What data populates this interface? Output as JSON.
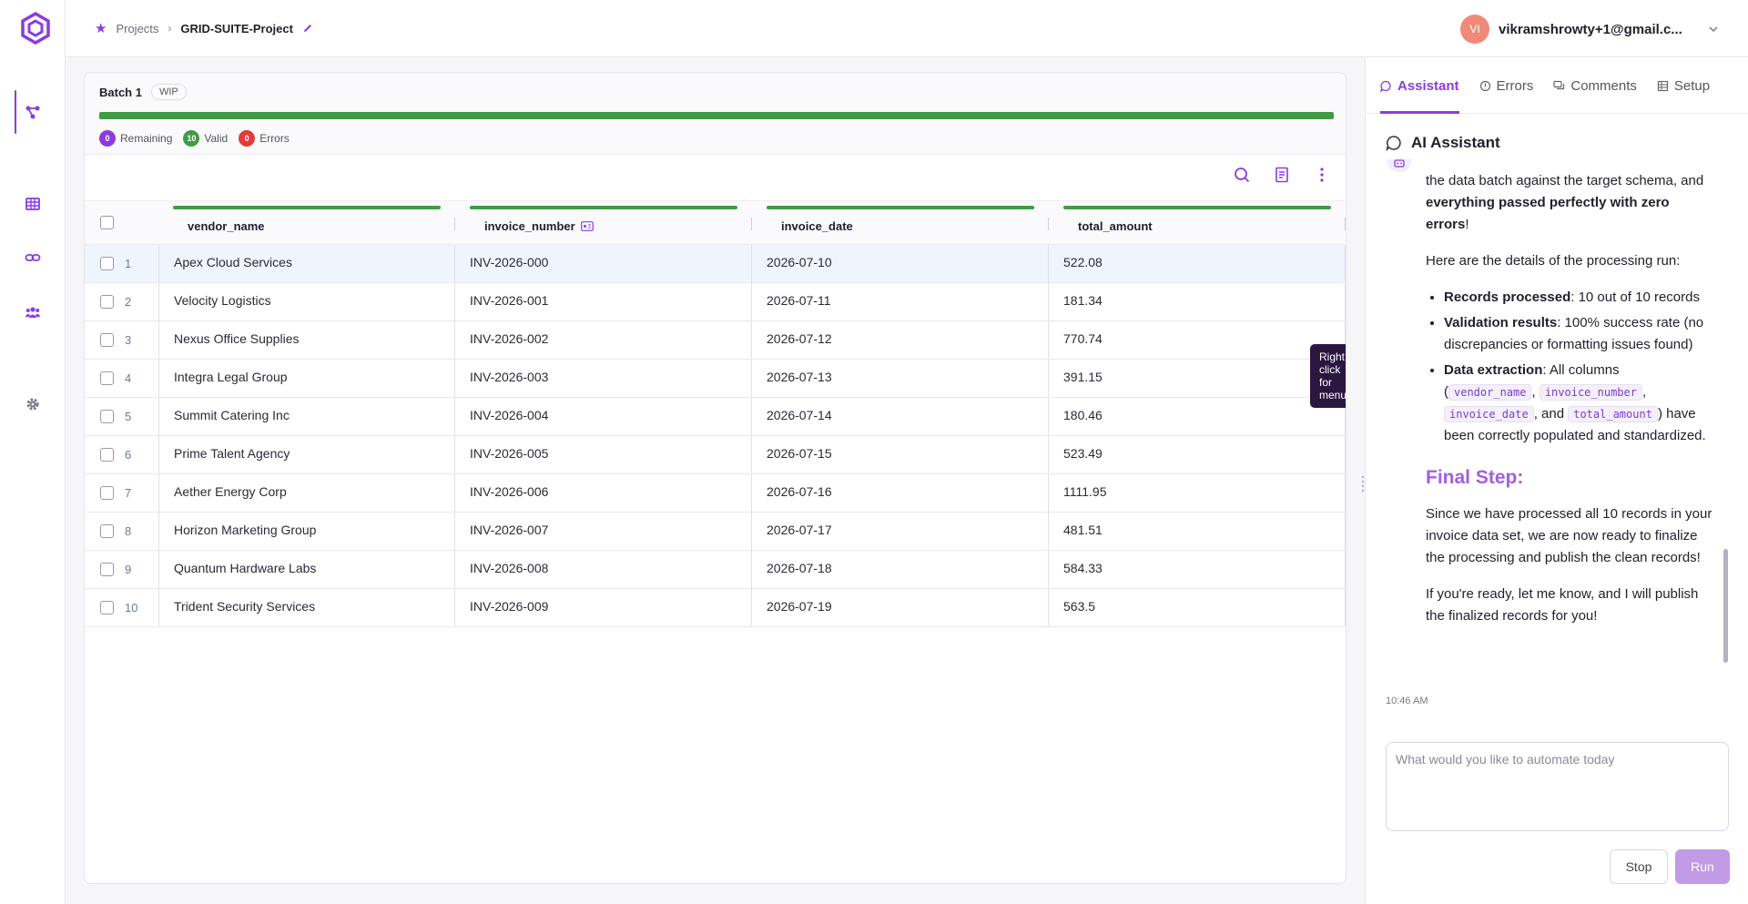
{
  "colors": {
    "accent": "#8a3ce0",
    "valid": "#3f9b45",
    "error": "#e23b3b",
    "remaining": "#8a3ce0"
  },
  "nav": [
    "workflow-icon",
    "table-icon",
    "link-icon",
    "users-icon",
    "settings-icon"
  ],
  "breadcrumb": {
    "projects": "Projects",
    "current": "GRID-SUITE-Project"
  },
  "user": {
    "initials": "VI",
    "email": "vikramshrowty+1@gmail.c..."
  },
  "batch": {
    "name": "Batch 1",
    "status": "WIP",
    "progress": 1.0,
    "stats": {
      "remaining_count": "0",
      "remaining_label": "Remaining",
      "valid_count": "10",
      "valid_label": "Valid",
      "error_count": "0",
      "error_label": "Errors"
    }
  },
  "table": {
    "columns": [
      "vendor_name",
      "invoice_number",
      "invoice_date",
      "total_amount"
    ],
    "rows": [
      {
        "num": "1",
        "vendor": "Apex Cloud Services",
        "invoice": "INV-2026-000",
        "date": "2026-07-10",
        "amount": "522.08"
      },
      {
        "num": "2",
        "vendor": "Velocity Logistics",
        "invoice": "INV-2026-001",
        "date": "2026-07-11",
        "amount": "181.34"
      },
      {
        "num": "3",
        "vendor": "Nexus Office Supplies",
        "invoice": "INV-2026-002",
        "date": "2026-07-12",
        "amount": "770.74"
      },
      {
        "num": "4",
        "vendor": "Integra Legal Group",
        "invoice": "INV-2026-003",
        "date": "2026-07-13",
        "amount": "391.15"
      },
      {
        "num": "5",
        "vendor": "Summit Catering Inc",
        "invoice": "INV-2026-004",
        "date": "2026-07-14",
        "amount": "180.46"
      },
      {
        "num": "6",
        "vendor": "Prime Talent Agency",
        "invoice": "INV-2026-005",
        "date": "2026-07-15",
        "amount": "523.49"
      },
      {
        "num": "7",
        "vendor": "Aether Energy Corp",
        "invoice": "INV-2026-006",
        "date": "2026-07-16",
        "amount": "1111.95"
      },
      {
        "num": "8",
        "vendor": "Horizon Marketing Group",
        "invoice": "INV-2026-007",
        "date": "2026-07-17",
        "amount": "481.51"
      },
      {
        "num": "9",
        "vendor": "Quantum Hardware Labs",
        "invoice": "INV-2026-008",
        "date": "2026-07-18",
        "amount": "584.33"
      },
      {
        "num": "10",
        "vendor": "Trident Security Services",
        "invoice": "INV-2026-009",
        "date": "2026-07-19",
        "amount": "563.5"
      }
    ],
    "tooltip": "Right click for menu"
  },
  "panel": {
    "tabs": [
      "Assistant",
      "Errors",
      "Comments",
      "Setup"
    ],
    "title": "AI Assistant",
    "message": {
      "p1_a": "the data batch against the target schema, and ",
      "p1_b": "everything passed perfectly with zero errors",
      "p1_c": "!",
      "p2": "Here are the details of the processing run:",
      "b1_label": "Records processed",
      "b1_text": ": 10 out of 10 records",
      "b2_label": "Validation results",
      "b2_text": ": 100% success rate (no discrepancies or formatting issues found)",
      "b3_label": "Data extraction",
      "b3_text_a": ": All columns (",
      "code1": "vendor_name",
      "code2": "invoice_number",
      "code3": "invoice_date",
      "sep_and": ", and ",
      "code4": "total_amount",
      "b3_text_b": ") have been correctly populated and standardized.",
      "final_heading": "Final Step:",
      "p3": "Since we have processed all 10 records in your invoice data set, we are now ready to finalize the processing and publish the clean records!",
      "p4": "If you're ready, let me know, and I will publish the finalized records for you!"
    },
    "time": "10:46 AM",
    "input_placeholder": "What would you like to automate today",
    "stop": "Stop",
    "run": "Run"
  }
}
